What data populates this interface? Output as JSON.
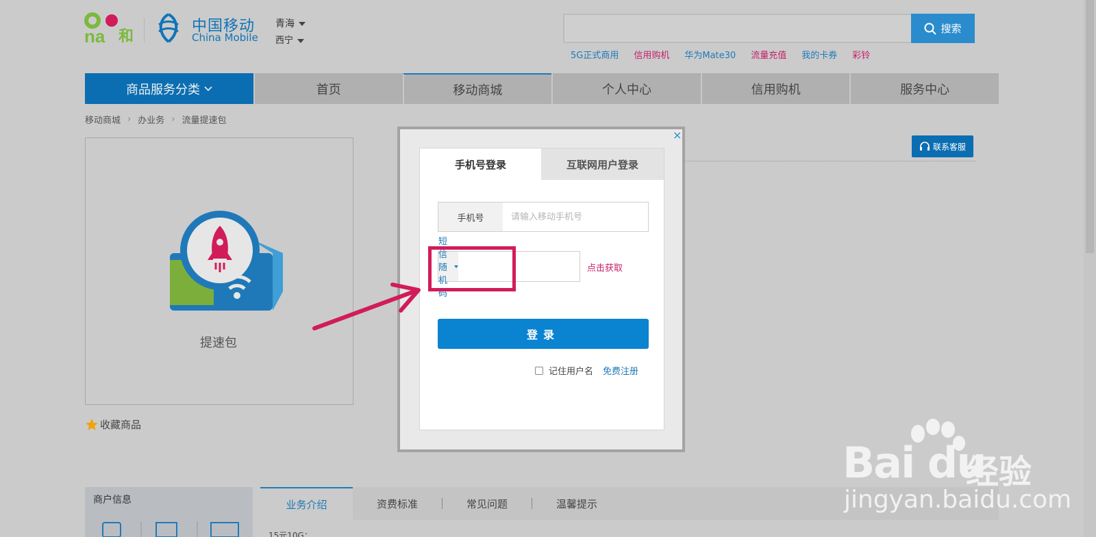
{
  "header": {
    "logo_and_text": "and",
    "logo_he": "和",
    "brand_cn": "中国移动",
    "brand_en": "China Mobile",
    "province": "青海",
    "city": "西宁",
    "search_value": "",
    "search_label": "搜索"
  },
  "hot_links": [
    {
      "label": "5G正式商用",
      "color": "#1f79b8"
    },
    {
      "label": "信用购机",
      "color": "#c51f6b"
    },
    {
      "label": "华为Mate30",
      "color": "#1f79b8"
    },
    {
      "label": "流量充值",
      "color": "#c51f6b"
    },
    {
      "label": "我的卡券",
      "color": "#1f79b8"
    },
    {
      "label": "彩铃",
      "color": "#c51f6b"
    }
  ],
  "nav": {
    "category": "商品服务分类",
    "items": [
      "首页",
      "移动商城",
      "个人中心",
      "信用购机",
      "服务中心"
    ]
  },
  "breadcrumb": [
    "移动商城",
    "办业务",
    "流量提速包"
  ],
  "product": {
    "name": "提速包",
    "favorite": "收藏商品"
  },
  "service_button": "联系客服",
  "merchant_title": "商户信息",
  "tabs": [
    "业务介绍",
    "资费标准",
    "常见问题",
    "温馨提示"
  ],
  "intro_text": "15元10G：",
  "modal": {
    "close": "×",
    "tab_phone": "手机号登录",
    "tab_internet": "互联网用户登录",
    "phone_label": "手机号",
    "phone_placeholder": "请输入移动手机号",
    "sms_select": "短信随机码",
    "get_code": "点击获取",
    "login": "登录",
    "remember": "记住用户名",
    "register": "免费注册"
  },
  "watermark": {
    "brand": "Bai du",
    "jingyan": "经验",
    "url": "jingyan.baidu.com"
  },
  "colors": {
    "brand_blue": "#0b6eb2",
    "accent_magenta": "#c51f6b",
    "highlight": "#d11c5a"
  }
}
